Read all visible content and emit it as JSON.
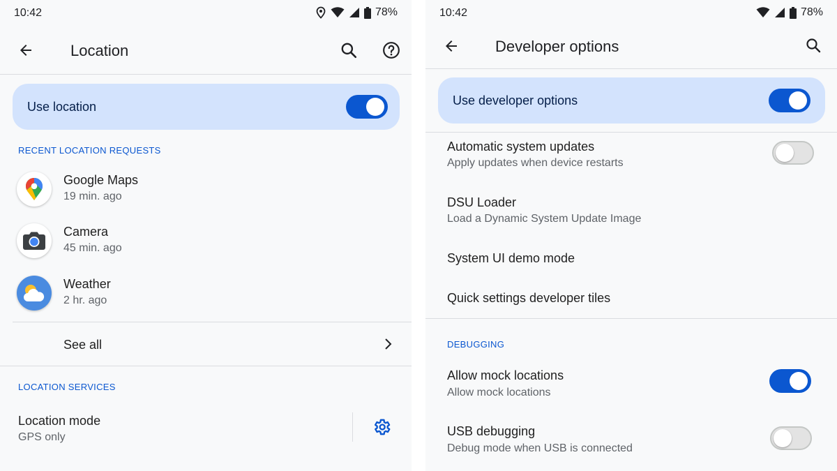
{
  "left": {
    "status": {
      "time": "10:42",
      "battery": "78%"
    },
    "title": "Location",
    "master": {
      "label": "Use location",
      "enabled": true
    },
    "recent_header": "RECENT LOCATION REQUESTS",
    "apps": [
      {
        "name": "Google Maps",
        "time": "19 min. ago",
        "icon": "google-maps-icon"
      },
      {
        "name": "Camera",
        "time": "45 min. ago",
        "icon": "camera-icon"
      },
      {
        "name": "Weather",
        "time": "2 hr. ago",
        "icon": "weather-icon"
      }
    ],
    "see_all": "See all",
    "services_header": "LOCATION SERVICES",
    "location_mode": {
      "title": "Location mode",
      "value": "GPS only"
    }
  },
  "right": {
    "status": {
      "time": "10:42",
      "battery": "78%"
    },
    "title": "Developer options",
    "master": {
      "label": "Use developer options",
      "enabled": true
    },
    "items": [
      {
        "title": "Automatic system updates",
        "summary": "Apply updates when device restarts",
        "toggle": false
      },
      {
        "title": "DSU Loader",
        "summary": "Load a Dynamic System Update Image"
      },
      {
        "title": "System UI demo mode"
      },
      {
        "title": "Quick settings developer tiles"
      }
    ],
    "debugging_header": "DEBUGGING",
    "debug_items": [
      {
        "title": "Allow mock locations",
        "summary": "Allow mock locations",
        "toggle": true
      },
      {
        "title": "USB debugging",
        "summary": "Debug mode when USB is connected",
        "toggle": false
      }
    ]
  },
  "colors": {
    "accent": "#0b57d0",
    "card": "#d3e3fd",
    "background": "#f8f9fa",
    "secondary_text": "#5f6368"
  }
}
